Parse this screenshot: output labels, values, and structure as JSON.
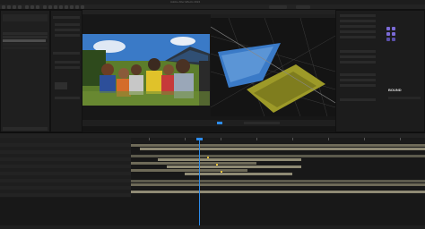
{
  "app": {
    "window_title": "Adobe After Effects 2024"
  },
  "toolbar": {
    "tools": [
      "home-icon",
      "selection-icon",
      "hand-icon",
      "zoom-icon",
      "orbit-icon",
      "pan-icon",
      "dolly-icon",
      "rectangle-icon",
      "pen-icon",
      "type-icon",
      "brush-icon",
      "clone-icon",
      "eraser-icon",
      "roto-icon",
      "puppet-icon"
    ]
  },
  "panels": {
    "project": {
      "tab": "Project"
    },
    "composition": {
      "tab": "Composition"
    },
    "effects": {
      "tab": "Effects & Presets"
    },
    "timeline": {
      "tab": "Timeline"
    }
  },
  "viewer": {
    "left_view": "Active Camera",
    "right_view": "Custom View"
  },
  "plugin": {
    "brand": "BOUND"
  },
  "colors": {
    "accent": "#2d8ceb",
    "playhead": "#2d8ceb",
    "layer_bar": "#8f8a74",
    "layer_bar_dark": "#6e6a58",
    "plane": "#9d9a28",
    "sky": "#3a7ac7",
    "pad_purple": "#7b6bd6"
  }
}
